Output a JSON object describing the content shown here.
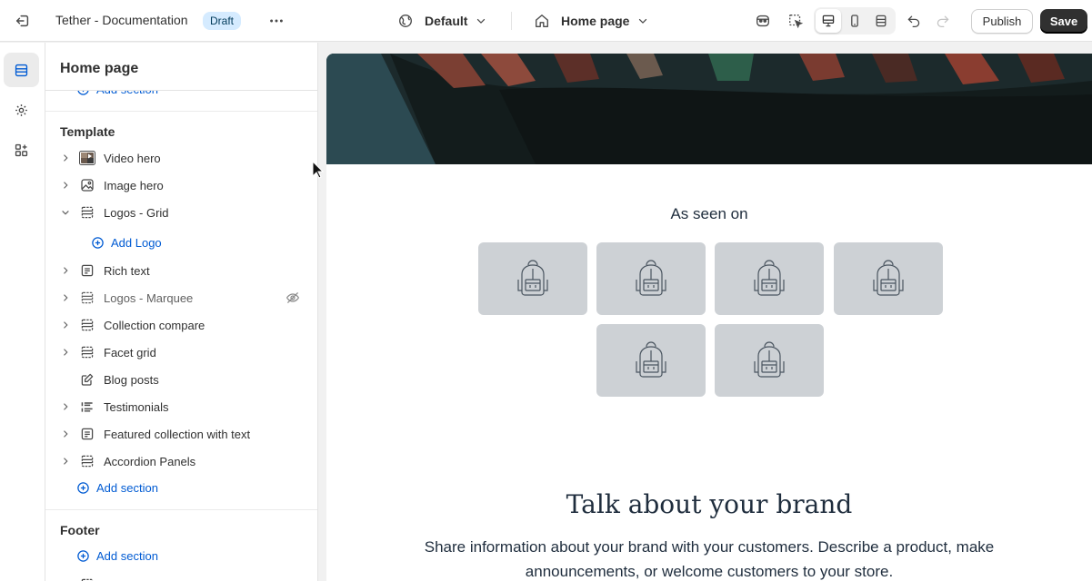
{
  "topbar": {
    "theme_name": "Tether - Documentation",
    "status_badge": "Draft",
    "theme_selector": "Default",
    "page_selector": "Home page",
    "publish_label": "Publish",
    "save_label": "Save",
    "icons": [
      "exit-icon",
      "more-icon",
      "globe-icon",
      "chevron-down-icon",
      "home-icon",
      "ai-icon",
      "inspector-icon",
      "desktop-icon",
      "mobile-icon",
      "fullwidth-icon",
      "undo-icon",
      "redo-icon"
    ]
  },
  "rail": {
    "items": [
      {
        "name": "sections-icon",
        "active": true
      },
      {
        "name": "gear-icon",
        "active": false
      },
      {
        "name": "apps-icon",
        "active": false
      }
    ]
  },
  "sidebar": {
    "title": "Home page",
    "header_add_section": "Add section",
    "template_heading": "Template",
    "template_items": [
      {
        "label": "Video hero",
        "icon": "video-thumb-icon",
        "expanded": false,
        "hidden": false
      },
      {
        "label": "Image hero",
        "icon": "image-icon",
        "expanded": false,
        "hidden": false
      },
      {
        "label": "Logos - Grid",
        "icon": "layout-icon",
        "expanded": true,
        "hidden": false
      },
      {
        "label": "Rich text",
        "icon": "text-block-icon",
        "expanded": false,
        "hidden": false
      },
      {
        "label": "Logos - Marquee",
        "icon": "layout-icon",
        "expanded": false,
        "hidden": true
      },
      {
        "label": "Collection compare",
        "icon": "layout-icon",
        "expanded": false,
        "hidden": false
      },
      {
        "label": "Facet grid",
        "icon": "layout-icon",
        "expanded": false,
        "hidden": false
      },
      {
        "label": "Blog posts",
        "icon": "blog-icon",
        "expanded": null,
        "hidden": false
      },
      {
        "label": "Testimonials",
        "icon": "list-icon",
        "expanded": false,
        "hidden": false
      },
      {
        "label": "Featured collection with text",
        "icon": "text-block-icon",
        "expanded": false,
        "hidden": false
      },
      {
        "label": "Accordion Panels",
        "icon": "layout-icon",
        "expanded": false,
        "hidden": false
      }
    ],
    "add_logo": "Add Logo",
    "template_add_section": "Add section",
    "footer_heading": "Footer",
    "footer_add_section": "Add section",
    "footer_partial": "Fo"
  },
  "preview": {
    "seen_on": "As seen on",
    "logo_count": 6,
    "brand_title": "Talk about your brand",
    "brand_text": "Share information about your brand with your customers. Describe a product, make announcements, or welcome customers to your store."
  },
  "colors": {
    "accent_blue": "#005bd3",
    "badge_bg": "#d5ebff",
    "save_bg": "#303030",
    "logo_card_bg": "#cdd1d5",
    "hero_bg": "#2c4a52"
  }
}
